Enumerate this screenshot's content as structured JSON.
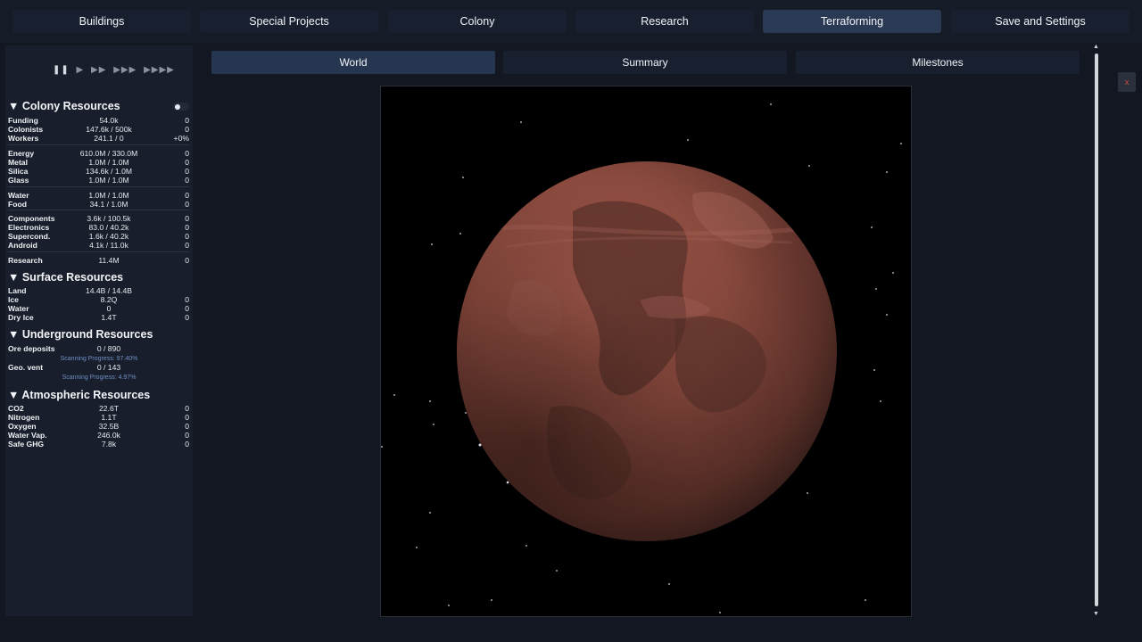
{
  "nav": {
    "tabs": [
      {
        "label": "Buildings"
      },
      {
        "label": "Special Projects"
      },
      {
        "label": "Colony"
      },
      {
        "label": "Research"
      },
      {
        "label": "Terraforming"
      },
      {
        "label": "Save and Settings"
      }
    ],
    "active_tab": "Terraforming"
  },
  "sidebar": {
    "speed_controls": [
      "pause-icon",
      "play-icon",
      "fast-forward-2-icon",
      "fast-forward-3-icon",
      "fast-forward-4-icon"
    ],
    "colony": {
      "title": "▼ Colony Resources",
      "rows": [
        {
          "name": "Funding",
          "value": "54.0k",
          "rate": "0"
        },
        {
          "name": "Colonists",
          "value": "147.6k / 500k",
          "rate": "0"
        },
        {
          "name": "Workers",
          "value": "241.1 / 0",
          "rate": "+0%"
        },
        {
          "name": "Energy",
          "value": "610.0M / 330.0M",
          "rate": "0"
        },
        {
          "name": "Metal",
          "value": "1.0M / 1.0M",
          "rate": "0"
        },
        {
          "name": "Silica",
          "value": "134.6k / 1.0M",
          "rate": "0"
        },
        {
          "name": "Glass",
          "value": "1.0M / 1.0M",
          "rate": "0"
        },
        {
          "name": "Water",
          "value": "1.0M / 1.0M",
          "rate": "0"
        },
        {
          "name": "Food",
          "value": "34.1 / 1.0M",
          "rate": "0"
        },
        {
          "name": "Components",
          "value": "3.6k / 100.5k",
          "rate": "0"
        },
        {
          "name": "Electronics",
          "value": "83.0 / 40.2k",
          "rate": "0"
        },
        {
          "name": "Supercond.",
          "value": "1.6k / 40.2k",
          "rate": "0"
        },
        {
          "name": "Android",
          "value": "4.1k / 11.0k",
          "rate": "0"
        },
        {
          "name": "Research",
          "value": "11.4M",
          "rate": "0"
        }
      ]
    },
    "surface": {
      "title": "▼ Surface Resources",
      "rows": [
        {
          "name": "Land",
          "value": "14.4B / 14.4B",
          "rate": ""
        },
        {
          "name": "Ice",
          "value": "8.2Q",
          "rate": "0"
        },
        {
          "name": "Water",
          "value": "0",
          "rate": "0"
        },
        {
          "name": "Dry Ice",
          "value": "1.4T",
          "rate": "0"
        }
      ]
    },
    "underground": {
      "title": "▼ Underground Resources",
      "rows": [
        {
          "name": "Ore deposits",
          "value": "0 / 890",
          "rate": "",
          "scan": "Scanning Progress: 97.40%"
        },
        {
          "name": "Geo. vent",
          "value": "0 / 143",
          "rate": "",
          "scan": "Scanning Progress: 4.97%"
        }
      ]
    },
    "atmospheric": {
      "title": "▼ Atmospheric Resources",
      "rows": [
        {
          "name": "CO2",
          "value": "22.6T",
          "rate": "0"
        },
        {
          "name": "Nitrogen",
          "value": "1.1T",
          "rate": "0"
        },
        {
          "name": "Oxygen",
          "value": "32.5B",
          "rate": "0"
        },
        {
          "name": "Water Vap.",
          "value": "246.0k",
          "rate": "0"
        },
        {
          "name": "Safe GHG",
          "value": "7.8k",
          "rate": "0"
        }
      ]
    }
  },
  "main": {
    "subtabs": [
      {
        "label": "World"
      },
      {
        "label": "Summary"
      },
      {
        "label": "Milestones"
      }
    ],
    "active_subtab": "World"
  },
  "close_button": {
    "label": "x"
  },
  "colors": {
    "background": "#121722",
    "active_tab": "#2a3a55",
    "planet": "#8a4a3e",
    "scan_text": "#6e8fc4"
  }
}
